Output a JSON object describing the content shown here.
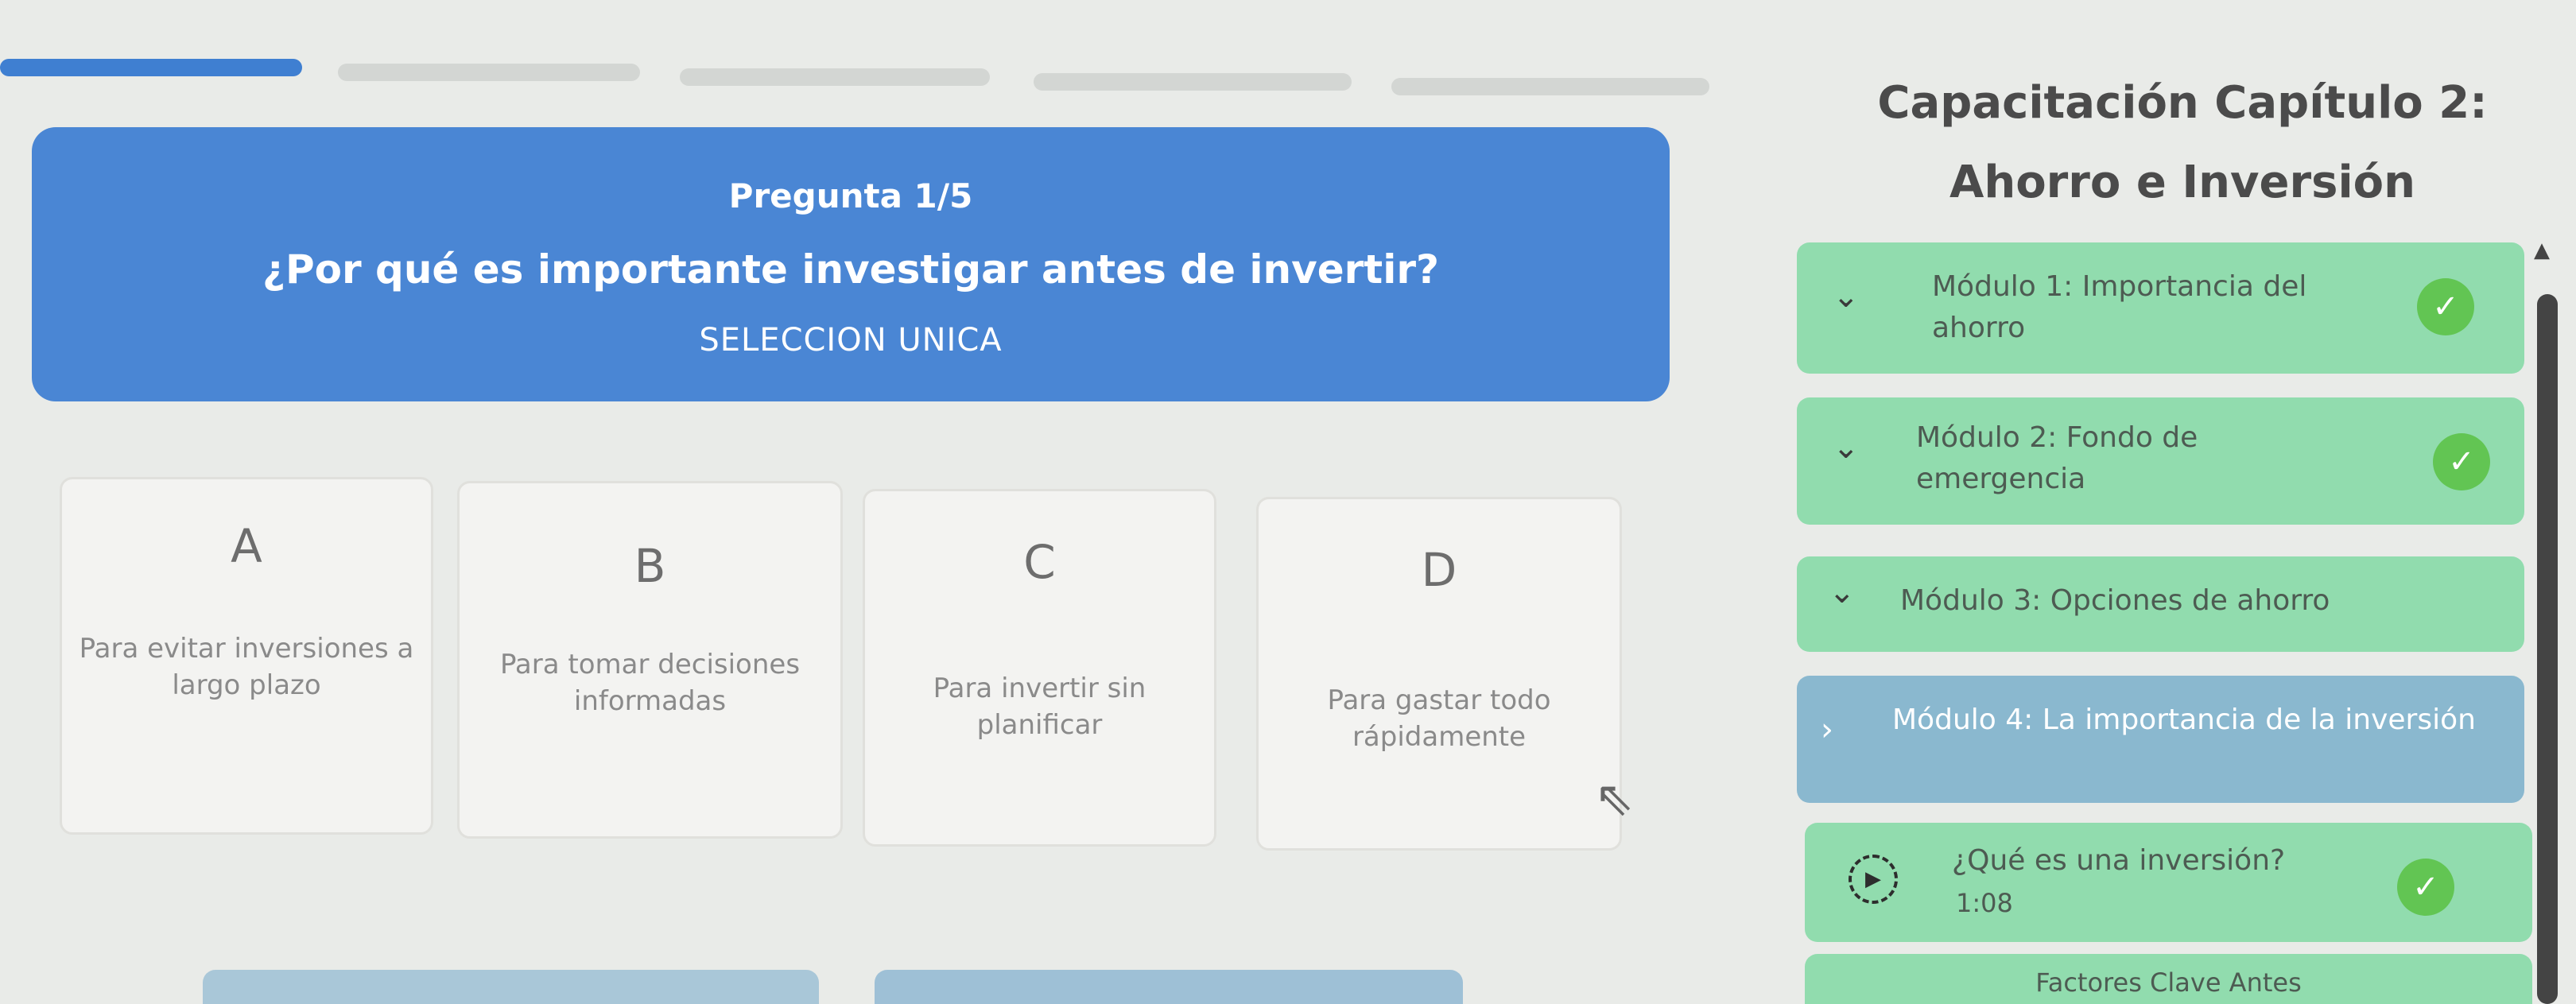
{
  "progress": {
    "current": 1,
    "total": 5
  },
  "question": {
    "counter": "Pregunta 1/5",
    "text": "¿Por qué es importante investigar antes de invertir?",
    "type": "SELECCION UNICA"
  },
  "options": [
    {
      "letter": "A",
      "text": "Para evitar inversiones a largo plazo"
    },
    {
      "letter": "B",
      "text": "Para tomar decisiones informadas"
    },
    {
      "letter": "C",
      "text": "Para invertir sin planificar"
    },
    {
      "letter": "D",
      "text": "Para gastar todo rápidamente"
    }
  ],
  "course": {
    "title": "Capacitación Capítulo 2: Ahorro e Inversión"
  },
  "modules": [
    {
      "title": "Módulo 1: Importancia del ahorro",
      "completed": true
    },
    {
      "title": "Módulo 2: Fondo de emergencia",
      "completed": true
    },
    {
      "title": "Módulo 3: Opciones de ahorro",
      "completed": false
    },
    {
      "title": "Módulo 4: La importancia de la inversión",
      "completed": false,
      "active": true
    }
  ],
  "lessons": [
    {
      "title": "¿Qué es una inversión?",
      "duration": "1:08",
      "completed": true
    },
    {
      "title": "Factores Clave Antes"
    }
  ],
  "colors": {
    "accent": "#4a86d4",
    "module_bg": "#91dcae",
    "module_active_bg": "#8ab8cf",
    "check": "#62c553"
  },
  "icons": {
    "module_expand": "chevron-down-icon",
    "module_collapsed": "chevron-right-icon",
    "completed": "check-icon",
    "lesson": "play-circle-icon"
  }
}
